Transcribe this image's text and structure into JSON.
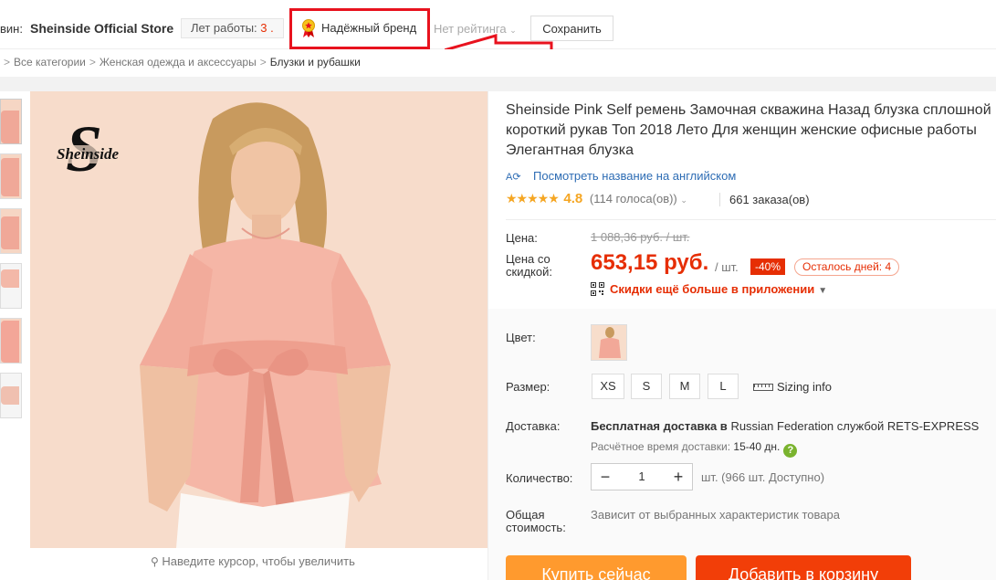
{
  "store": {
    "label_prefix": "вин:",
    "name": "Sheinside Official Store",
    "years_label": "Лет работы:",
    "years_value": "3 .",
    "brand_badge": "Надёжный бренд",
    "rating": "Нет рейтинга",
    "save_button": "Сохранить"
  },
  "breadcrumb": {
    "items": [
      "Все категории",
      "Женская одежда и аксессуары"
    ],
    "current": "Блузки и рубашки",
    "separator": ">"
  },
  "image": {
    "brand_logo": "Sheinside",
    "zoom_hint": "Наведите курсор, чтобы увеличить"
  },
  "product": {
    "title": "Sheinside Pink Self ремень Замочная скважина Назад блузка сплошной короткий рукав Топ 2018 Лето Для женщин женские офисные работы Элегантная блузка",
    "translate_link": "Посмотреть название на английском",
    "stars": "★★★★★",
    "rating": "4.8",
    "votes": "(114 голоса(ов))",
    "orders": "661 заказа(ов)"
  },
  "price": {
    "label": "Цена:",
    "old": "1 088,36 руб. / шт.",
    "discount_label_1": "Цена со",
    "discount_label_2": "скидкой:",
    "new": "653,15 руб.",
    "per_unit": "/ шт.",
    "discount": "-40%",
    "days_left": "Осталось дней: 4",
    "app_promo": "Скидки ещё больше в приложении"
  },
  "options": {
    "color_label": "Цвет:",
    "size_label": "Размер:",
    "sizes": [
      "XS",
      "S",
      "M",
      "L"
    ],
    "sizing_info": "Sizing info",
    "shipping_label": "Доставка:",
    "shipping_free": "Бесплатная доставка в",
    "shipping_rest": "Russian Federation службой",
    "shipping_carrier": "RETS-EXPRESS",
    "ship_time_label": "Расчётное время доставки:",
    "ship_time_value": "15-40 дн.",
    "qty_label": "Количество:",
    "qty_value": "1",
    "qty_note": "шт. (966 шт. Доступно)",
    "total_label_1": "Общая",
    "total_label_2": "стоимость:",
    "total_note": "Зависит от выбранных характеристик товара"
  },
  "actions": {
    "buy_now": "Купить сейчас",
    "add_to_cart": "Добавить в корзину"
  },
  "colors": {
    "price_red": "#e62e04",
    "link_blue": "#2d6cb4",
    "star_orange": "#f5a623",
    "highlight_red": "#e8121e",
    "buy_orange": "#ff9a2e",
    "cart_red": "#f23e08"
  }
}
